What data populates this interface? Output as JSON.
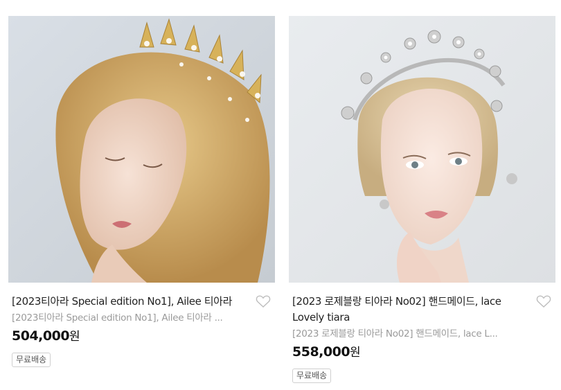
{
  "products": [
    {
      "title": "[2023티아라 Special edition No1], Ailee 티아라",
      "subtitle": "[2023티아라 Special edition No1], Ailee 티아라 ...",
      "price": "504,000",
      "currency": "원",
      "badge": "무료배송",
      "image_icon": "product-photo-gold-tiara",
      "wishlist_icon": "heart-outline-icon"
    },
    {
      "title": "[2023 로제블랑 티아라 No02] 핸드메이드, lace Lovely tiara",
      "subtitle": "[2023 로제블랑 티아라 No02] 핸드메이드, lace L...",
      "price": "558,000",
      "currency": "원",
      "badge": "무료배송",
      "image_icon": "product-photo-silver-tiara",
      "wishlist_icon": "heart-outline-icon"
    }
  ],
  "colors": {
    "subtitle": "#9a9a9a",
    "badge_border": "#cfcfcf",
    "price": "#111111"
  }
}
